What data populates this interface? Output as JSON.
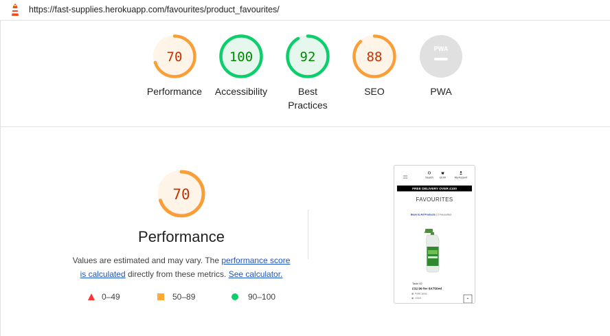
{
  "browser": {
    "url": "https://fast-supplies.herokuapp.com/favourites/product_favourites/"
  },
  "categories": [
    {
      "label": "Performance",
      "score": "70",
      "fraction": 0.7,
      "status": "average",
      "color": "#fa9e38",
      "bg": "#fff4e8",
      "text_color": "#c33300"
    },
    {
      "label": "Accessibility",
      "score": "100",
      "fraction": 1.0,
      "status": "pass",
      "color": "#0cce6b",
      "bg": "#e6f7ee",
      "text_color": "#008800"
    },
    {
      "label": "Best Practices",
      "score": "92",
      "fraction": 0.92,
      "status": "pass",
      "color": "#0cce6b",
      "bg": "#e6f7ee",
      "text_color": "#008800"
    },
    {
      "label": "SEO",
      "score": "88",
      "fraction": 0.88,
      "status": "average",
      "color": "#fa9e38",
      "bg": "#fff4e8",
      "text_color": "#c33300"
    },
    {
      "label": "PWA",
      "score": "",
      "fraction": 0,
      "status": "na",
      "color": "#e0e0e0",
      "bg": "#e0e0e0",
      "text_color": "#9e9e9e",
      "icon_text": "PWA"
    }
  ],
  "performance": {
    "score": "70",
    "fraction": 0.7,
    "title": "Performance",
    "desc_prefix": "Values are estimated and may vary. The ",
    "link_score_a": "performance score",
    "link_score_b": "is calculated",
    "desc_middle": " directly from these metrics. ",
    "link_calculator": "See calculator."
  },
  "legend": [
    {
      "range": "0–49",
      "shape": "triangle",
      "color": "#ff3333"
    },
    {
      "range": "50–89",
      "shape": "square",
      "color": "#ffaa33"
    },
    {
      "range": "90–100",
      "shape": "circle",
      "color": "#0cce6b"
    }
  ],
  "screenshot": {
    "nav_search": "Search",
    "nav_cart": "£0.00",
    "nav_account": "My Account",
    "banner": "FREE DELIVERY OVER £100",
    "heading": "FAVOURITES",
    "back_link": "Back to All Products",
    "fav_count": "| 2 Favourites",
    "product_name": "Taski 92",
    "product_price": "£32.99 for 6X750ml",
    "product_cat": "Public areas",
    "product_rating": "4.91/5"
  }
}
